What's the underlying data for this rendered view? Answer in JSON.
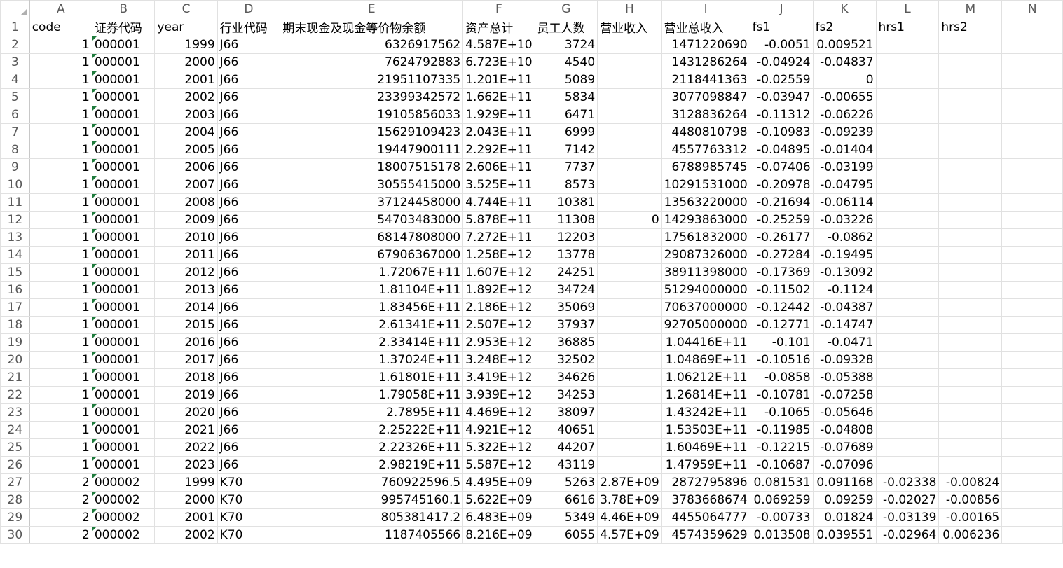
{
  "columns": [
    "A",
    "B",
    "C",
    "D",
    "E",
    "F",
    "G",
    "H",
    "I",
    "J",
    "K",
    "L",
    "M",
    "N"
  ],
  "rows": [
    {
      "n": "1",
      "A": "code",
      "B": "证券代码",
      "C": "year",
      "D": "行业代码",
      "E": "期末现金及现金等价物余额",
      "F": "资产总计",
      "G": "员工人数",
      "H": "营业收入",
      "I": "营业总收入",
      "J": "fs1",
      "K": "fs2",
      "L": "hrs1",
      "M": "hrs2",
      "N": ""
    },
    {
      "n": "2",
      "A": "1",
      "B": "000001",
      "C": "1999",
      "D": "J66",
      "E": "6326917562",
      "F": "4.587E+10",
      "G": "3724",
      "H": "",
      "I": "1471220690",
      "J": "-0.0051",
      "K": "0.009521",
      "L": "",
      "M": "",
      "N": ""
    },
    {
      "n": "3",
      "A": "1",
      "B": "000001",
      "C": "2000",
      "D": "J66",
      "E": "7624792883",
      "F": "6.723E+10",
      "G": "4540",
      "H": "",
      "I": "1431286264",
      "J": "-0.04924",
      "K": "-0.04837",
      "L": "",
      "M": "",
      "N": ""
    },
    {
      "n": "4",
      "A": "1",
      "B": "000001",
      "C": "2001",
      "D": "J66",
      "E": "21951107335",
      "F": "1.201E+11",
      "G": "5089",
      "H": "",
      "I": "2118441363",
      "J": "-0.02559",
      "K": "0",
      "L": "",
      "M": "",
      "N": ""
    },
    {
      "n": "5",
      "A": "1",
      "B": "000001",
      "C": "2002",
      "D": "J66",
      "E": "23399342572",
      "F": "1.662E+11",
      "G": "5834",
      "H": "",
      "I": "3077098847",
      "J": "-0.03947",
      "K": "-0.00655",
      "L": "",
      "M": "",
      "N": ""
    },
    {
      "n": "6",
      "A": "1",
      "B": "000001",
      "C": "2003",
      "D": "J66",
      "E": "19105856033",
      "F": "1.929E+11",
      "G": "6471",
      "H": "",
      "I": "3128836264",
      "J": "-0.11312",
      "K": "-0.06226",
      "L": "",
      "M": "",
      "N": ""
    },
    {
      "n": "7",
      "A": "1",
      "B": "000001",
      "C": "2004",
      "D": "J66",
      "E": "15629109423",
      "F": "2.043E+11",
      "G": "6999",
      "H": "",
      "I": "4480810798",
      "J": "-0.10983",
      "K": "-0.09239",
      "L": "",
      "M": "",
      "N": ""
    },
    {
      "n": "8",
      "A": "1",
      "B": "000001",
      "C": "2005",
      "D": "J66",
      "E": "19447900111",
      "F": "2.292E+11",
      "G": "7142",
      "H": "",
      "I": "4557763312",
      "J": "-0.04895",
      "K": "-0.01404",
      "L": "",
      "M": "",
      "N": ""
    },
    {
      "n": "9",
      "A": "1",
      "B": "000001",
      "C": "2006",
      "D": "J66",
      "E": "18007515178",
      "F": "2.606E+11",
      "G": "7737",
      "H": "",
      "I": "6788985745",
      "J": "-0.07406",
      "K": "-0.03199",
      "L": "",
      "M": "",
      "N": ""
    },
    {
      "n": "10",
      "A": "1",
      "B": "000001",
      "C": "2007",
      "D": "J66",
      "E": "30555415000",
      "F": "3.525E+11",
      "G": "8573",
      "H": "",
      "I": "10291531000",
      "J": "-0.20978",
      "K": "-0.04795",
      "L": "",
      "M": "",
      "N": ""
    },
    {
      "n": "11",
      "A": "1",
      "B": "000001",
      "C": "2008",
      "D": "J66",
      "E": "37124458000",
      "F": "4.744E+11",
      "G": "10381",
      "H": "",
      "I": "13563220000",
      "J": "-0.21694",
      "K": "-0.06114",
      "L": "",
      "M": "",
      "N": ""
    },
    {
      "n": "12",
      "A": "1",
      "B": "000001",
      "C": "2009",
      "D": "J66",
      "E": "54703483000",
      "F": "5.878E+11",
      "G": "11308",
      "H": "0",
      "I": "14293863000",
      "J": "-0.25259",
      "K": "-0.03226",
      "L": "",
      "M": "",
      "N": ""
    },
    {
      "n": "13",
      "A": "1",
      "B": "000001",
      "C": "2010",
      "D": "J66",
      "E": "68147808000",
      "F": "7.272E+11",
      "G": "12203",
      "H": "",
      "I": "17561832000",
      "J": "-0.26177",
      "K": "-0.0862",
      "L": "",
      "M": "",
      "N": ""
    },
    {
      "n": "14",
      "A": "1",
      "B": "000001",
      "C": "2011",
      "D": "J66",
      "E": "67906367000",
      "F": "1.258E+12",
      "G": "13778",
      "H": "",
      "I": "29087326000",
      "J": "-0.27284",
      "K": "-0.19495",
      "L": "",
      "M": "",
      "N": ""
    },
    {
      "n": "15",
      "A": "1",
      "B": "000001",
      "C": "2012",
      "D": "J66",
      "E": "1.72067E+11",
      "F": "1.607E+12",
      "G": "24251",
      "H": "",
      "I": "38911398000",
      "J": "-0.17369",
      "K": "-0.13092",
      "L": "",
      "M": "",
      "N": ""
    },
    {
      "n": "16",
      "A": "1",
      "B": "000001",
      "C": "2013",
      "D": "J66",
      "E": "1.81104E+11",
      "F": "1.892E+12",
      "G": "34724",
      "H": "",
      "I": "51294000000",
      "J": "-0.11502",
      "K": "-0.1124",
      "L": "",
      "M": "",
      "N": ""
    },
    {
      "n": "17",
      "A": "1",
      "B": "000001",
      "C": "2014",
      "D": "J66",
      "E": "1.83456E+11",
      "F": "2.186E+12",
      "G": "35069",
      "H": "",
      "I": "70637000000",
      "J": "-0.12442",
      "K": "-0.04387",
      "L": "",
      "M": "",
      "N": ""
    },
    {
      "n": "18",
      "A": "1",
      "B": "000001",
      "C": "2015",
      "D": "J66",
      "E": "2.61341E+11",
      "F": "2.507E+12",
      "G": "37937",
      "H": "",
      "I": "92705000000",
      "J": "-0.12771",
      "K": "-0.14747",
      "L": "",
      "M": "",
      "N": ""
    },
    {
      "n": "19",
      "A": "1",
      "B": "000001",
      "C": "2016",
      "D": "J66",
      "E": "2.33414E+11",
      "F": "2.953E+12",
      "G": "36885",
      "H": "",
      "I": "1.04416E+11",
      "J": "-0.101",
      "K": "-0.0471",
      "L": "",
      "M": "",
      "N": ""
    },
    {
      "n": "20",
      "A": "1",
      "B": "000001",
      "C": "2017",
      "D": "J66",
      "E": "1.37024E+11",
      "F": "3.248E+12",
      "G": "32502",
      "H": "",
      "I": "1.04869E+11",
      "J": "-0.10516",
      "K": "-0.09328",
      "L": "",
      "M": "",
      "N": ""
    },
    {
      "n": "21",
      "A": "1",
      "B": "000001",
      "C": "2018",
      "D": "J66",
      "E": "1.61801E+11",
      "F": "3.419E+12",
      "G": "34626",
      "H": "",
      "I": "1.06212E+11",
      "J": "-0.0858",
      "K": "-0.05388",
      "L": "",
      "M": "",
      "N": ""
    },
    {
      "n": "22",
      "A": "1",
      "B": "000001",
      "C": "2019",
      "D": "J66",
      "E": "1.79058E+11",
      "F": "3.939E+12",
      "G": "34253",
      "H": "",
      "I": "1.26814E+11",
      "J": "-0.10781",
      "K": "-0.07258",
      "L": "",
      "M": "",
      "N": ""
    },
    {
      "n": "23",
      "A": "1",
      "B": "000001",
      "C": "2020",
      "D": "J66",
      "E": "2.7895E+11",
      "F": "4.469E+12",
      "G": "38097",
      "H": "",
      "I": "1.43242E+11",
      "J": "-0.1065",
      "K": "-0.05646",
      "L": "",
      "M": "",
      "N": ""
    },
    {
      "n": "24",
      "A": "1",
      "B": "000001",
      "C": "2021",
      "D": "J66",
      "E": "2.25222E+11",
      "F": "4.921E+12",
      "G": "40651",
      "H": "",
      "I": "1.53503E+11",
      "J": "-0.11985",
      "K": "-0.04808",
      "L": "",
      "M": "",
      "N": ""
    },
    {
      "n": "25",
      "A": "1",
      "B": "000001",
      "C": "2022",
      "D": "J66",
      "E": "2.22326E+11",
      "F": "5.322E+12",
      "G": "44207",
      "H": "",
      "I": "1.60469E+11",
      "J": "-0.12215",
      "K": "-0.07689",
      "L": "",
      "M": "",
      "N": ""
    },
    {
      "n": "26",
      "A": "1",
      "B": "000001",
      "C": "2023",
      "D": "J66",
      "E": "2.98219E+11",
      "F": "5.587E+12",
      "G": "43119",
      "H": "",
      "I": "1.47959E+11",
      "J": "-0.10687",
      "K": "-0.07096",
      "L": "",
      "M": "",
      "N": ""
    },
    {
      "n": "27",
      "A": "2",
      "B": "000002",
      "C": "1999",
      "D": "K70",
      "E": "760922596.5",
      "F": "4.495E+09",
      "G": "5263",
      "H": "2.87E+09",
      "I": "2872795896",
      "J": "0.081531",
      "K": "0.091168",
      "L": "-0.02338",
      "M": "-0.00824",
      "N": ""
    },
    {
      "n": "28",
      "A": "2",
      "B": "000002",
      "C": "2000",
      "D": "K70",
      "E": "995745160.1",
      "F": "5.622E+09",
      "G": "6616",
      "H": "3.78E+09",
      "I": "3783668674",
      "J": "0.069259",
      "K": "0.09259",
      "L": "-0.02027",
      "M": "-0.00856",
      "N": ""
    },
    {
      "n": "29",
      "A": "2",
      "B": "000002",
      "C": "2001",
      "D": "K70",
      "E": "805381417.2",
      "F": "6.483E+09",
      "G": "5349",
      "H": "4.46E+09",
      "I": "4455064777",
      "J": "-0.00733",
      "K": "0.01824",
      "L": "-0.03139",
      "M": "-0.00165",
      "N": ""
    },
    {
      "n": "30",
      "A": "2",
      "B": "000002",
      "C": "2002",
      "D": "K70",
      "E": "1187405566",
      "F": "8.216E+09",
      "G": "6055",
      "H": "4.57E+09",
      "I": "4574359629",
      "J": "0.013508",
      "K": "0.039551",
      "L": "-0.02964",
      "M": "0.006236",
      "N": ""
    }
  ]
}
